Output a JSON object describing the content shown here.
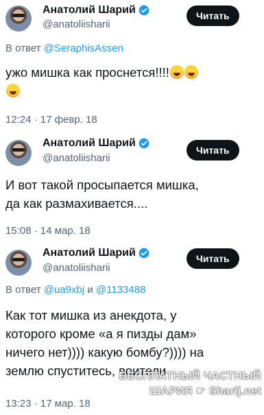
{
  "tweets": [
    {
      "author": "Анатолий Шарий",
      "handle": "@anatoliisharii",
      "follow_label": "Читать",
      "reply_prefix": "В ответ ",
      "reply_mentions": [
        "@SeraphisAssen"
      ],
      "text": "ужо мишка как проснется!!!!",
      "emoji": "rolling-on-floor-laughing",
      "time": "12:24 · 17 февр. 18"
    },
    {
      "author": "Анатолий Шарий",
      "handle": "@anatoliisharii",
      "follow_label": "Читать",
      "text_lines": [
        "И вот такой просыпается мишка,",
        "да как размахивается...."
      ],
      "time": "15:08 · 14 мар. 18"
    },
    {
      "author": "Анатолий Шарий",
      "handle": "@anatoliisharii",
      "follow_label": "Читать",
      "reply_prefix": "В ответ ",
      "reply_mentions": [
        "@ua9xbj",
        "@1133488"
      ],
      "reply_joiner": " и ",
      "text_lines": [
        "Как тот мишка из анекдота, у",
        "которого кроме «а я пизды дам»",
        "ничего нет)))) какую бомбу?)))) на",
        "землю спуститесь, воители"
      ],
      "time": "13:23 · 17 мар. 18"
    }
  ],
  "watermark": {
    "line1": "БЕСПЛАТНЫЙ ЧАСТНЫЙ",
    "line2a": "ШАРИЯ",
    "line2b": "Sharij.net"
  },
  "colors": {
    "text": "#0f1419",
    "secondary": "#536471",
    "link": "#1d9bf0",
    "verified": "#1d9bf0",
    "button_bg": "#0f1419"
  }
}
